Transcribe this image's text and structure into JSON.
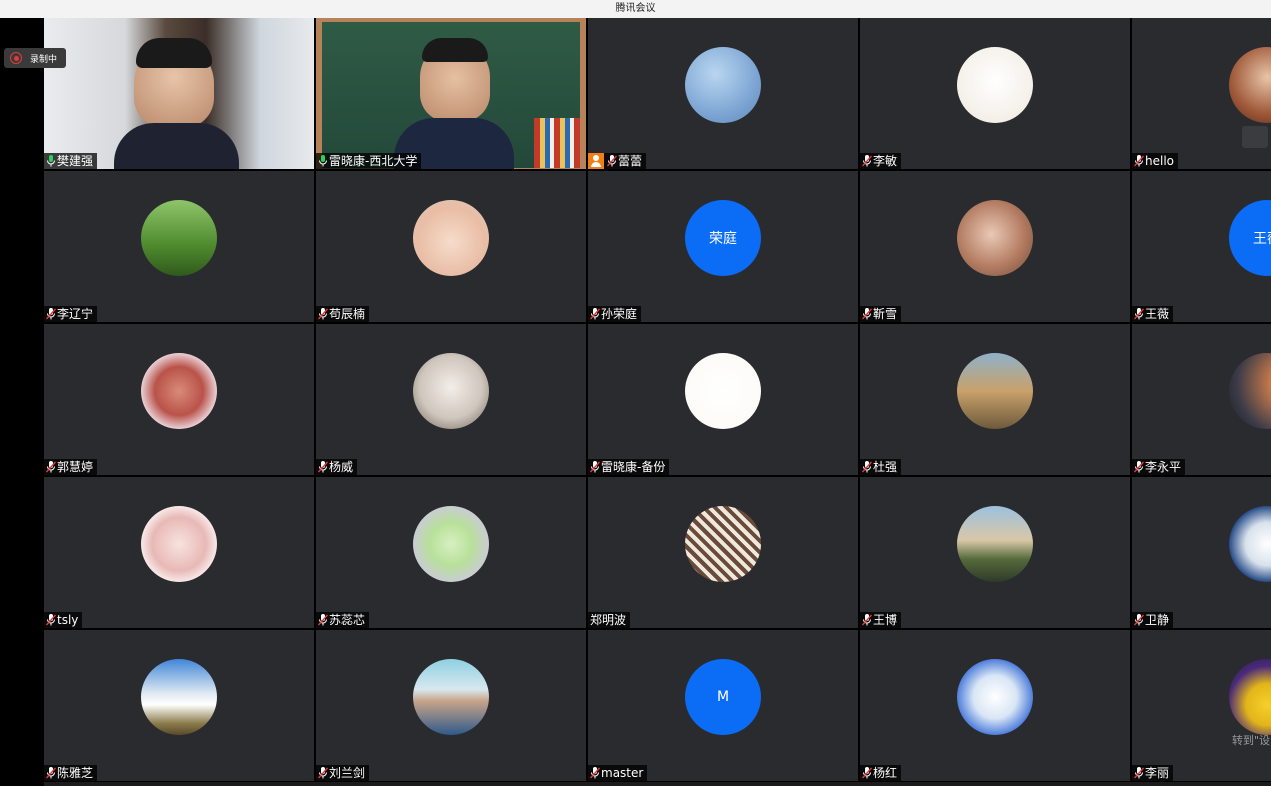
{
  "window": {
    "title": "腾讯会议"
  },
  "recording": {
    "label": "录制中"
  },
  "participants": [
    {
      "name": "樊建强",
      "mic": "on",
      "kind": "video-office"
    },
    {
      "name": "雷晓康-西北大学",
      "mic": "on",
      "kind": "video-board"
    },
    {
      "name": "蕾蕾",
      "mic": "muted",
      "kind": "photo-sky",
      "host": true
    },
    {
      "name": "李敏",
      "mic": "muted",
      "kind": "cartoon-girl"
    },
    {
      "name": "hello",
      "mic": "muted",
      "kind": "photo-woman"
    },
    {
      "name": "李辽宁",
      "mic": "muted",
      "kind": "photo-green"
    },
    {
      "name": "苟辰楠",
      "mic": "muted",
      "kind": "photo-baby"
    },
    {
      "name": "孙荣庭",
      "mic": "muted",
      "kind": "text",
      "initials": "荣庭"
    },
    {
      "name": "靳雪",
      "mic": "muted",
      "kind": "photo-child"
    },
    {
      "name": "王薇",
      "mic": "muted",
      "kind": "text",
      "initials": "王薇"
    },
    {
      "name": "郭慧婷",
      "mic": "muted",
      "kind": "photo-frame"
    },
    {
      "name": "杨威",
      "mic": "muted",
      "kind": "photo-cat"
    },
    {
      "name": "雷晓康-备份",
      "mic": "muted",
      "kind": "cartoon-man"
    },
    {
      "name": "杜强",
      "mic": "muted",
      "kind": "photo-castle"
    },
    {
      "name": "李永平",
      "mic": "muted",
      "kind": "photo-sunset"
    },
    {
      "name": "tsly",
      "mic": "muted",
      "kind": "photo-bride"
    },
    {
      "name": "苏蕊芯",
      "mic": "muted",
      "kind": "drawing"
    },
    {
      "name": "郑明波",
      "mic": "none",
      "kind": "photo-dogs"
    },
    {
      "name": "王博",
      "mic": "muted",
      "kind": "photo-disney"
    },
    {
      "name": "卫静",
      "mic": "muted",
      "kind": "photo-plate"
    },
    {
      "name": "陈雅芝",
      "mic": "muted",
      "kind": "photo-clouds"
    },
    {
      "name": "刘兰剑",
      "mic": "muted",
      "kind": "photo-man"
    },
    {
      "name": "master",
      "mic": "muted",
      "kind": "text",
      "initials": "M"
    },
    {
      "name": "杨红",
      "mic": "muted",
      "kind": "photo-snowtree"
    },
    {
      "name": "李丽",
      "mic": "muted",
      "kind": "photo-pansy"
    }
  ],
  "cutoff_text": "转到\"设",
  "colors": {
    "tile_bg": "#2a2b2f",
    "active_border": "#2fd15c",
    "avatar_blue": "#0b6cf5",
    "host_badge": "#f07f17"
  }
}
